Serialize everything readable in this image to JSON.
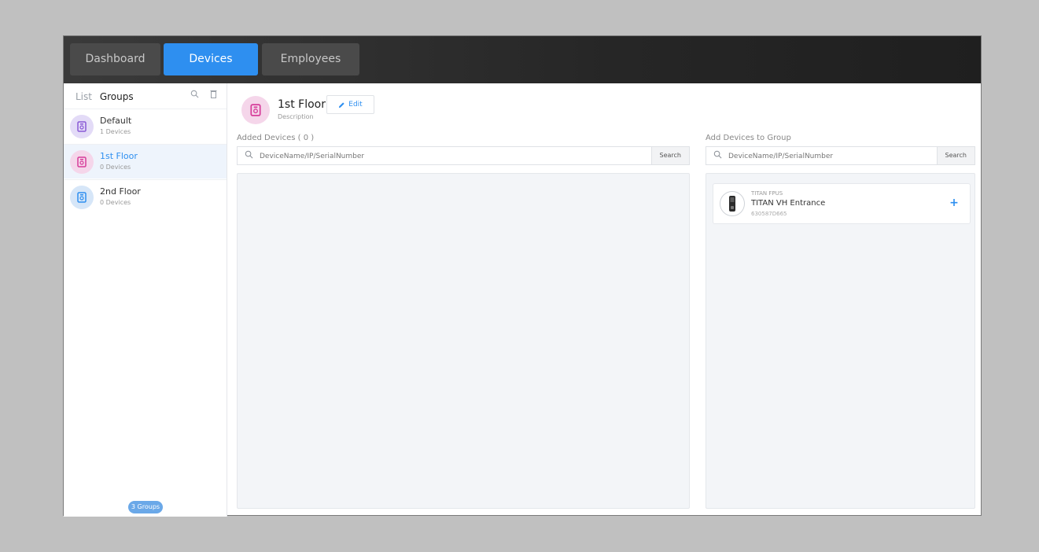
{
  "tabs": [
    {
      "label": "Dashboard",
      "active": false
    },
    {
      "label": "Devices",
      "active": true
    },
    {
      "label": "Employees",
      "active": false
    }
  ],
  "sidebar": {
    "list_label": "List",
    "groups_label": "Groups",
    "search_icon": "search-icon",
    "delete_icon": "trash-icon",
    "groups": [
      {
        "name": "Default",
        "count": "1 Devices",
        "color": "#d9d0f5",
        "icon_color": "#8a5ad6"
      },
      {
        "name": "1st Floor",
        "count": "0 Devices",
        "color": "#f5d6ea",
        "icon_color": "#d63d9a"
      },
      {
        "name": "2nd Floor",
        "count": "0 Devices",
        "color": "#d6e6f8",
        "icon_color": "#2e8ff0"
      }
    ],
    "groups_count_badge": "3 Groups"
  },
  "group_header": {
    "title": "1st Floor",
    "description": "Description",
    "edit_label": "Edit"
  },
  "added_devices": {
    "label": "Added Devices ( 0 )",
    "search_placeholder": "DeviceName/IP/SerialNumber",
    "search_button": "Search"
  },
  "add_devices": {
    "label": "Add Devices to Group",
    "search_placeholder": "DeviceName/IP/SerialNumber",
    "search_button": "Search",
    "devices": [
      {
        "model": "TITAN FPUS",
        "name": "TITAN VH Entrance",
        "serial": "630587D665"
      }
    ]
  },
  "colors": {
    "accent": "#2e8ff0",
    "topbar": "#2a2a2a"
  }
}
